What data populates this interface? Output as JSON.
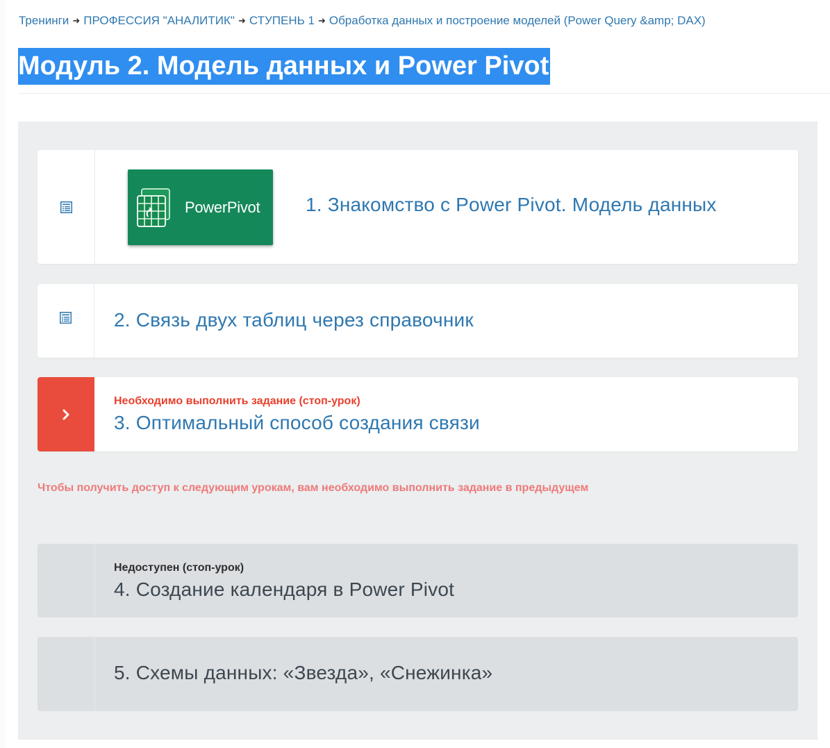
{
  "breadcrumb": {
    "items": [
      "Тренинги",
      "ПРОФЕССИЯ \"АНАЛИТИК\"",
      "СТУПЕНЬ 1",
      "Обработка данных и построение моделей (Power Query &amp; DAX)"
    ],
    "separator": "➜"
  },
  "page": {
    "title": "Модуль 2. Модель данных и Power Pivot"
  },
  "lessons": [
    {
      "title": "1. Знакомство с Power Pivot. Модель данных",
      "thumbnail_text": "PowerPivot",
      "icon": "list-icon"
    },
    {
      "title": "2. Связь двух таблиц через справочник",
      "icon": "list-icon"
    },
    {
      "title": "3. Оптимальный способ создания связи",
      "status": "Необходимо выполнить задание (стоп-урок)",
      "icon": "chevron-right-icon"
    },
    {
      "title": "4. Создание календаря в Power Pivot",
      "status": "Недоступен (стоп-урок)"
    },
    {
      "title": "5. Схемы данных: «Звезда», «Снежинка»"
    }
  ],
  "notice": "Чтобы получить доступ к следующим урокам, вам необходимо выполнить задание в предыдущем",
  "colors": {
    "link": "#2f78b0",
    "title_highlight": "#2f8ef0",
    "stop_accent": "#e94c3c",
    "notice": "#ee7a7a",
    "thumbnail_green": "#15885a",
    "locked_bg": "#dcdfe2"
  }
}
